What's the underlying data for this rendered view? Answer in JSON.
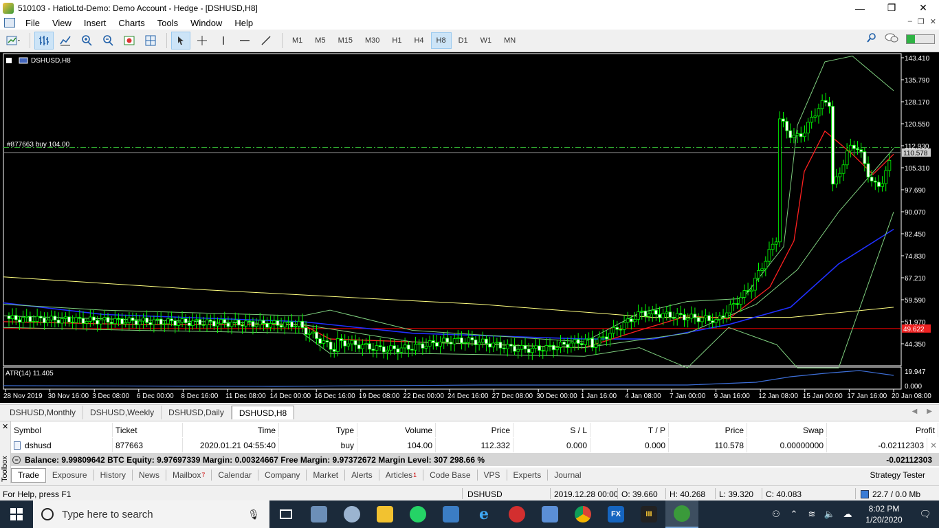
{
  "window": {
    "title": "510103 - HatioLtd-Demo: Demo Account - Hedge - [DSHUSD,H8]",
    "controls": [
      "—",
      "❐",
      "✕"
    ]
  },
  "menu": [
    "File",
    "View",
    "Insert",
    "Charts",
    "Tools",
    "Window",
    "Help"
  ],
  "timeframes": [
    "M1",
    "M5",
    "M15",
    "M30",
    "H1",
    "H4",
    "H8",
    "D1",
    "W1",
    "MN"
  ],
  "active_timeframe": "H8",
  "chart": {
    "symbol_label": "DSHUSD,H8",
    "order_label": "#877663 buy 104.00",
    "current_price": "110.578",
    "red_line_price": "49.622",
    "atr_label": "ATR(14) 11.405",
    "atr_axis": [
      "19.947",
      "0.000"
    ],
    "price_axis": [
      "143.410",
      "135.790",
      "128.170",
      "120.550",
      "112.930",
      "105.310",
      "97.690",
      "90.070",
      "82.450",
      "74.830",
      "67.210",
      "59.590",
      "51.970",
      "44.350"
    ],
    "time_axis": [
      "28 Nov 2019",
      "30 Nov 16:00",
      "3 Dec 08:00",
      "6 Dec 00:00",
      "8 Dec 16:00",
      "11 Dec 08:00",
      "14 Dec 00:00",
      "16 Dec 16:00",
      "19 Dec 08:00",
      "22 Dec 00:00",
      "24 Dec 16:00",
      "27 Dec 08:00",
      "30 Dec 00:00",
      "1 Jan 16:00",
      "4 Jan 08:00",
      "7 Jan 00:00",
      "9 Jan 16:00",
      "12 Jan 08:00",
      "15 Jan 00:00",
      "17 Jan 16:00",
      "20 Jan 08:00"
    ],
    "colors": {
      "background": "#000000",
      "bull": "#00ff00",
      "bear": "#ffffff",
      "ma_red": "#ff2020",
      "ma_blue": "#2030ff",
      "ma_yellow": "#ffff80",
      "bands": "#7fcf7f",
      "price_line": "#ff0000"
    }
  },
  "chart_tabs": [
    "DSHUSD,Monthly",
    "DSHUSD,Weekly",
    "DSHUSD,Daily",
    "DSHUSD,H8"
  ],
  "active_chart_tab": "DSHUSD,H8",
  "trade_table": {
    "headers": [
      "Symbol",
      "Ticket",
      "Time",
      "Type",
      "Volume",
      "Price",
      "S / L",
      "T / P",
      "Price",
      "Swap",
      "Profit"
    ],
    "rows": [
      [
        "dshusd",
        "877663",
        "2020.01.21 04:55:40",
        "buy",
        "104.00",
        "112.332",
        "0.000",
        "0.000",
        "110.578",
        "0.00000000",
        "-0.02112303"
      ]
    ]
  },
  "balance": {
    "text": "Balance: 9.99809642 BTC  Equity: 9.97697339  Margin: 0.00324667  Free Margin: 9.97372672  Margin Level: 307 298.66 %",
    "profit": "-0.02112303"
  },
  "toolbox_label": "Toolbox",
  "terminal_tabs": [
    {
      "label": "Trade",
      "badge": ""
    },
    {
      "label": "Exposure",
      "badge": ""
    },
    {
      "label": "History",
      "badge": ""
    },
    {
      "label": "News",
      "badge": ""
    },
    {
      "label": "Mailbox",
      "badge": "7"
    },
    {
      "label": "Calendar",
      "badge": ""
    },
    {
      "label": "Company",
      "badge": ""
    },
    {
      "label": "Market",
      "badge": ""
    },
    {
      "label": "Alerts",
      "badge": ""
    },
    {
      "label": "Articles",
      "badge": "1"
    },
    {
      "label": "Code Base",
      "badge": ""
    },
    {
      "label": "VPS",
      "badge": ""
    },
    {
      "label": "Experts",
      "badge": ""
    },
    {
      "label": "Journal",
      "badge": ""
    }
  ],
  "strategy_tester": "Strategy Tester",
  "status": {
    "help": "For Help, press F1",
    "symbol": "DSHUSD",
    "datetime": "2019.12.28 00:00",
    "open": "O: 39.660",
    "high": "H: 40.268",
    "low": "L: 39.320",
    "close": "C: 40.083",
    "traffic": "22.7 / 0.0 Mb"
  },
  "taskbar": {
    "search_placeholder": "Type here to search",
    "time": "8:02 PM",
    "date": "1/20/2020"
  }
}
